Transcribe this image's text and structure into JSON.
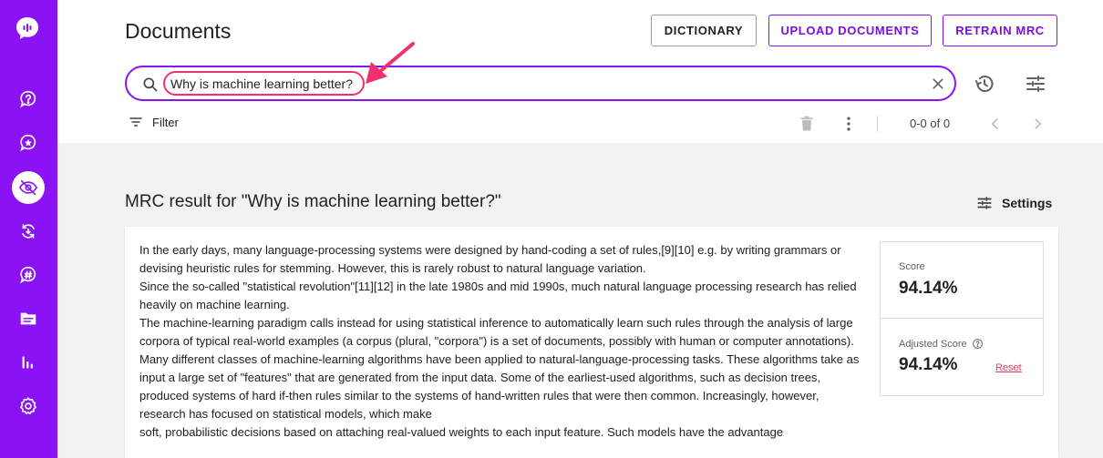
{
  "header": {
    "title": "Documents",
    "buttons": {
      "dictionary": "DICTIONARY",
      "upload": "UPLOAD DOCUMENTS",
      "retrain": "RETRAIN MRC"
    }
  },
  "search": {
    "value": "Why is machine learning better?"
  },
  "toolbar": {
    "filter_label": "Filter",
    "pagination": "0-0 of 0"
  },
  "mrc": {
    "title": "MRC result for \"Why is machine learning better?\"",
    "settings_label": "Settings",
    "paragraphs": [
      "In the early days, many language-processing systems were designed by hand-coding a set of rules,[9][10] e.g. by writing grammars or devising heuristic rules for stemming. However, this is rarely robust to natural language variation.",
      "Since the so-called \"statistical revolution\"[11][12] in the late 1980s and mid 1990s, much natural language processing research has relied heavily on machine learning.",
      "The machine-learning paradigm calls instead for using statistical inference to automatically learn such rules through the analysis of large corpora of typical real-world examples (a corpus (plural, \"corpora\") is a set of documents, possibly with human or computer annotations).",
      "Many different classes of machine-learning algorithms have been applied to natural-language-processing tasks. These algorithms take as input a large set of \"features\" that are generated from the input data. Some of the earliest-used algorithms, such as decision trees, produced systems of hard if-then rules similar to the systems of hand-written rules that were then common. Increasingly, however, research has focused on statistical models, which make",
      "soft, probabilistic decisions based on attaching real-valued weights to each input feature. Such models have the advantage"
    ],
    "score": {
      "label": "Score",
      "value": "94.14%"
    },
    "adjusted": {
      "label": "Adjusted Score",
      "value": "94.14%",
      "reset": "Reset"
    }
  },
  "colors": {
    "brand_purple": "#8a12f5",
    "highlight_pink": "#f0306f",
    "reset_red": "#e5385b"
  },
  "icons": {
    "sidebar": [
      "logo-icon",
      "help-icon",
      "star-icon",
      "eye-icon",
      "sync-icon",
      "hashtag-icon",
      "document-icon",
      "chart-icon",
      "settings-icon"
    ]
  }
}
